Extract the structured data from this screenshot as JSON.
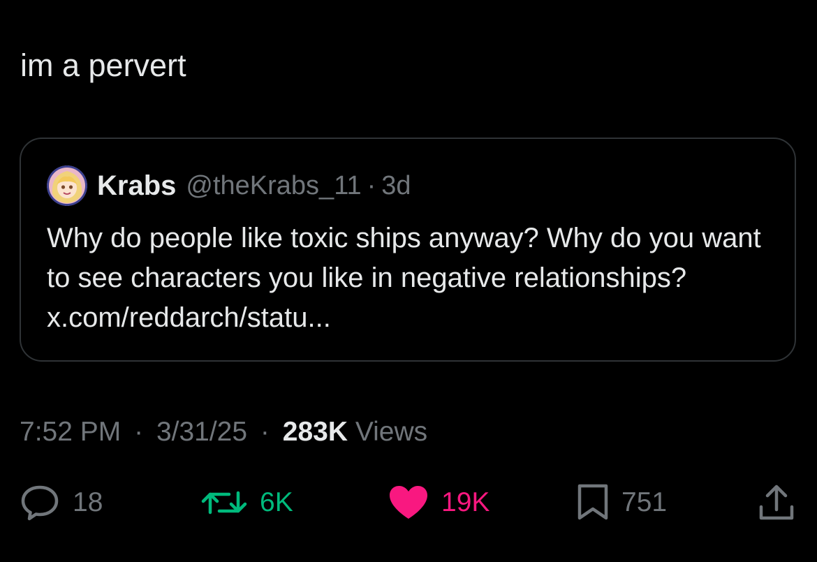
{
  "tweet": {
    "text": "im a pervert"
  },
  "quote": {
    "name": "Krabs",
    "handle": "@theKrabs_11",
    "separator": "·",
    "age": "3d",
    "text": "Why do people like toxic ships anyway? Why do you want to see characters you like in negative relationships? x.com/reddarch/statu..."
  },
  "meta": {
    "time": "7:52 PM",
    "date": "3/31/25",
    "separator": "·",
    "views_count": "283K",
    "views_label": "Views"
  },
  "actions": {
    "replies": "18",
    "reposts": "6K",
    "likes": "19K",
    "bookmarks": "751"
  },
  "colors": {
    "background": "#000000",
    "text": "#e7e9ea",
    "muted": "#71767b",
    "border": "#2f3336",
    "repost_green": "#00ba7c",
    "like_pink": "#f91880"
  },
  "icons": {
    "reply": "speech-bubble-icon",
    "repost": "repost-arrows-icon",
    "like": "heart-icon",
    "bookmark": "bookmark-icon",
    "share": "share-upload-icon"
  }
}
